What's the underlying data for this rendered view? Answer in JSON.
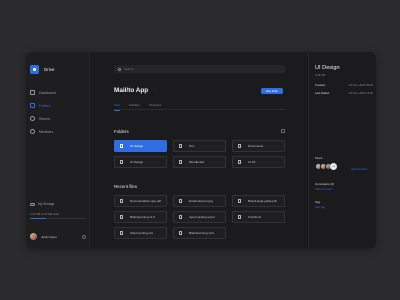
{
  "sidebar": {
    "brand": "Drive",
    "nav": [
      {
        "label": "Dashboard",
        "icon": "dashboard-icon",
        "active": false
      },
      {
        "label": "Folders",
        "icon": "folder-icon",
        "active": true
      },
      {
        "label": "Recent",
        "icon": "clock-icon",
        "active": false
      },
      {
        "label": "Members",
        "icon": "members-icon",
        "active": false
      }
    ],
    "storage": {
      "title": "My Storage",
      "usage_text": "4.24 GB of 15 GB used",
      "used_fraction": 0.28
    },
    "user": {
      "name": "Justin Ryan"
    }
  },
  "main": {
    "search_placeholder": "Search",
    "title": "Mail/to App",
    "title_more": "···",
    "new_button": "New folder",
    "tabs": [
      {
        "label": "Files",
        "active": true
      },
      {
        "label": "Activities",
        "active": false
      },
      {
        "label": "Info/notes",
        "active": false
      }
    ],
    "folders_title": "Folders",
    "folders": [
      {
        "label": "UI Design",
        "active": true
      },
      {
        "label": "Doc",
        "active": false
      },
      {
        "label": "Documents",
        "active": false
      },
      {
        "label": "UI Design",
        "active": false
      },
      {
        "label": "Moodboard",
        "active": false
      },
      {
        "label": "UI Kit",
        "active": false
      }
    ],
    "recent_title": "Recent files",
    "recent": [
      {
        "label": "Documentation app.pdf"
      },
      {
        "label": "Email-client-ui.jpg"
      },
      {
        "label": "Brand-style-guide.pdf"
      },
      {
        "label": "Brainstorming v1.0"
      },
      {
        "label": "report-testing.excel"
      },
      {
        "label": "Functions"
      },
      {
        "label": "Client-sorting.css"
      },
      {
        "label": "Brainstorming v2.0"
      }
    ]
  },
  "details": {
    "title": "UI Design",
    "size": "4.26 GB",
    "created_label": "Created",
    "created_value": "23 Nov, 2019 09:45",
    "edited_label": "Last Edited",
    "edited_value": "23 Nov, 2019 14:30",
    "team_label": "Team",
    "add_members": "Add members",
    "team_more": "+3",
    "comments_label": "Comments (4)",
    "add_comment": "Add Comment",
    "tag_label": "Tag",
    "add_tag": "Add Tag"
  },
  "colors": {
    "accent": "#2f6de1",
    "background": "#1b1b1d",
    "page": "#2b2b2d"
  }
}
